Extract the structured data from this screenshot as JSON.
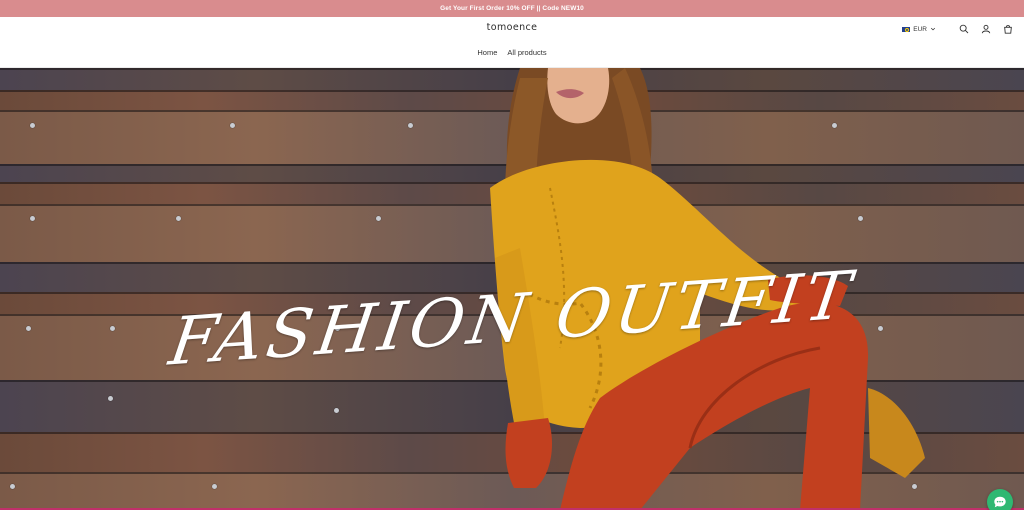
{
  "announcement": {
    "text": "Get Your First Order 10% OFF || Code NEW10"
  },
  "header": {
    "logo": "tomoence",
    "nav": [
      {
        "label": "Home"
      },
      {
        "label": "All products"
      }
    ],
    "currency": {
      "code": "EUR",
      "flag_icon": "eu-flag-icon"
    },
    "icons": [
      "search-icon",
      "account-icon",
      "cart-icon"
    ]
  },
  "hero": {
    "title": "FASHION OUTFIT"
  },
  "chat": {
    "icon": "chat-bubble-icon"
  },
  "colors": {
    "announcement_bg": "#d98c8e",
    "chat_button": "#2eb872",
    "sweater": "#e0a31c",
    "pants": "#c2401f"
  }
}
